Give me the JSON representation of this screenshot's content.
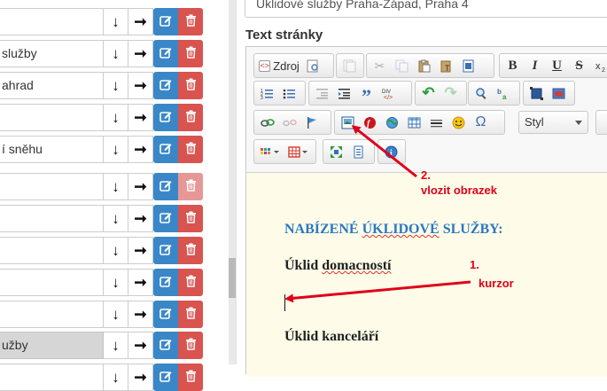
{
  "list": {
    "rows": [
      {
        "label": "",
        "selected": false,
        "light_delete": false
      },
      {
        "label": " služby",
        "selected": false,
        "light_delete": false
      },
      {
        "label": "ahrad",
        "selected": false,
        "light_delete": false
      },
      {
        "label": "",
        "selected": false,
        "light_delete": false
      },
      {
        "label": "í sněhu",
        "selected": false,
        "light_delete": false
      },
      {
        "label": "",
        "selected": false,
        "light_delete": true
      },
      {
        "label": "",
        "selected": false,
        "light_delete": false
      },
      {
        "label": "",
        "selected": false,
        "light_delete": false
      },
      {
        "label": "",
        "selected": false,
        "light_delete": false
      },
      {
        "label": "",
        "selected": false,
        "light_delete": false
      },
      {
        "label": "užby",
        "selected": true,
        "light_delete": false
      },
      {
        "label": "",
        "selected": false,
        "light_delete": false
      }
    ]
  },
  "editor": {
    "address_value": "Úklidové služby Praha-Západ, Praha 4",
    "text_label": "Text stránky",
    "source_label": "Zdroj",
    "style_combo": "Styl",
    "content": {
      "heading_part1": "NABÍZENÉ ",
      "heading_part2": "ÚKLIDOVÉ",
      "heading_part3": " SLUŽBY:",
      "para1_part1": "Úklid ",
      "para1_part2": "domacností",
      "para2": "Úklid kanceláří"
    }
  },
  "annotations": {
    "a2_number": "2.",
    "a2_text": "vlozit obrazek",
    "a1_number": "1.",
    "a1_text": "kurzor",
    "color": "#e0001a"
  },
  "colors": {
    "edit_button": "#3a87c7",
    "delete_button": "#d9534f",
    "heading": "#2a78c3",
    "content_background": "#fefce8"
  }
}
